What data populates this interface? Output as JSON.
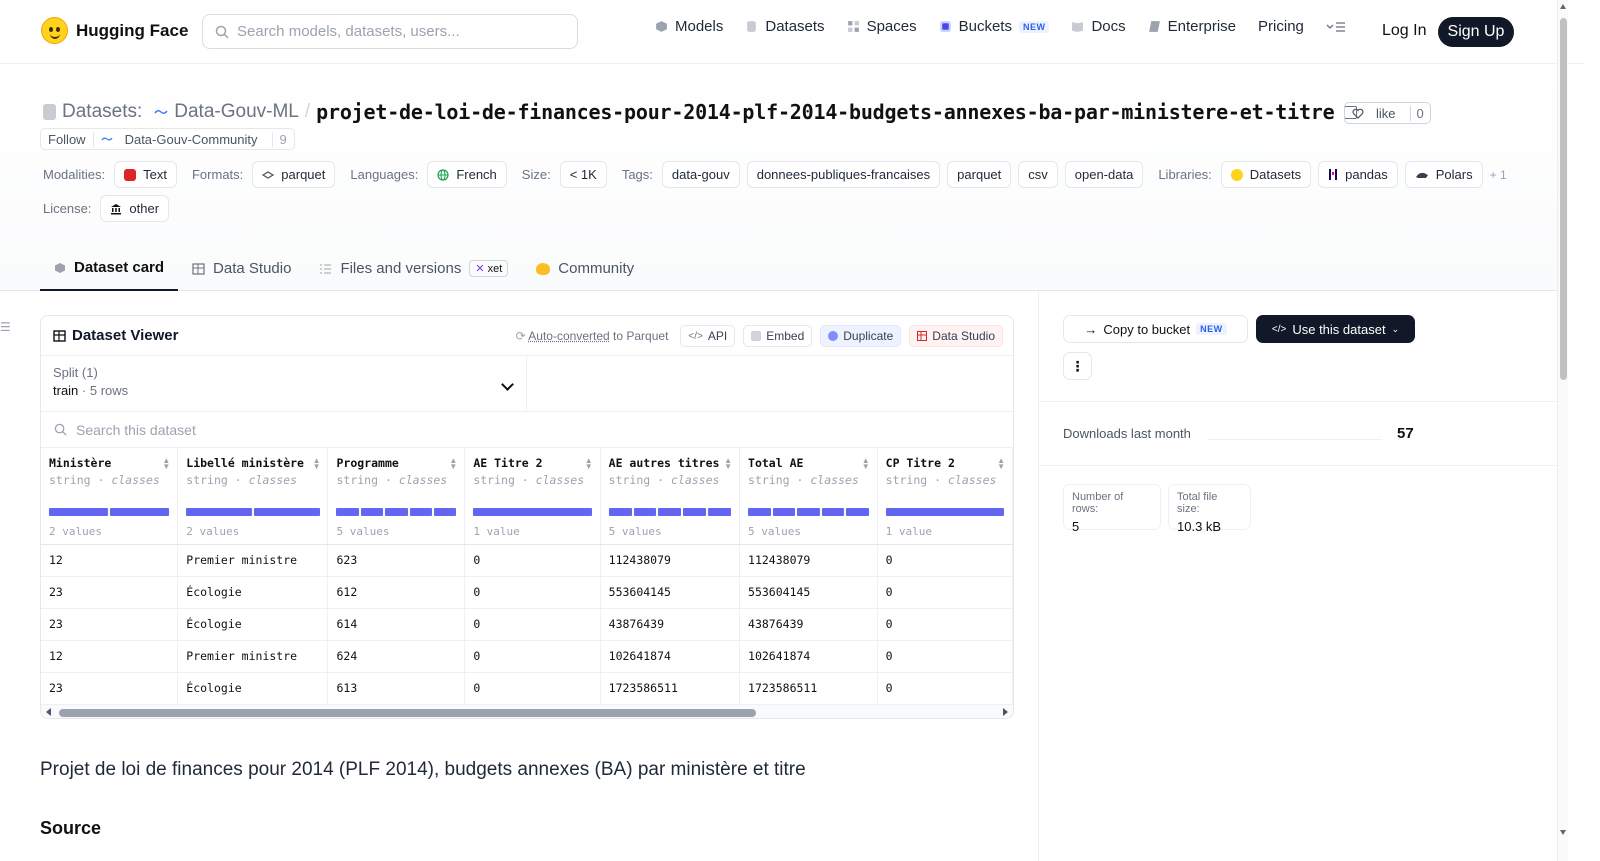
{
  "nav": {
    "brand": "Hugging Face",
    "search_placeholder": "Search models, datasets, users...",
    "links": [
      {
        "label": "Models",
        "icon": "cube-icon"
      },
      {
        "label": "Datasets",
        "icon": "database-icon"
      },
      {
        "label": "Spaces",
        "icon": "grid-icon"
      },
      {
        "label": "Buckets",
        "icon": "bucket-icon",
        "badge": "NEW"
      },
      {
        "label": "Docs",
        "icon": "book-icon"
      },
      {
        "label": "Enterprise",
        "icon": "enterprise-icon"
      },
      {
        "label": "Pricing"
      }
    ],
    "login": "Log In",
    "signup": "Sign Up"
  },
  "header": {
    "datasets_label": "Datasets:",
    "org": "Data-Gouv-ML",
    "separator": "/",
    "slug": "projet-de-loi-de-finances-pour-2014-plf-2014-budgets-annexes-ba-par-ministere-et-titre",
    "like_label": "like",
    "like_count": "0",
    "follow_label": "Follow",
    "community_name": "Data-Gouv-Community",
    "follow_count": "9"
  },
  "tags": {
    "modalities_label": "Modalities:",
    "modalities": [
      "Text"
    ],
    "formats_label": "Formats:",
    "formats": [
      "parquet"
    ],
    "languages_label": "Languages:",
    "languages": [
      "French"
    ],
    "size_label": "Size:",
    "size": "< 1K",
    "tags_label": "Tags:",
    "tags": [
      "data-gouv",
      "donnees-publiques-francaises",
      "parquet",
      "csv",
      "open-data"
    ],
    "libraries_label": "Libraries:",
    "libraries": [
      "Datasets",
      "pandas",
      "Polars"
    ],
    "libraries_more": "+ 1",
    "license_label": "License:",
    "license": "other"
  },
  "tabs": [
    {
      "label": "Dataset card",
      "active": true
    },
    {
      "label": "Data Studio"
    },
    {
      "label": "Files and versions",
      "badge": "xet"
    },
    {
      "label": "Community"
    }
  ],
  "viewer": {
    "title": "Dataset Viewer",
    "auto_converted": "Auto-converted",
    "to_parquet": "to Parquet",
    "api": "API",
    "embed": "Embed",
    "duplicate": "Duplicate",
    "data_studio": "Data Studio",
    "split_label": "Split (1)",
    "split_value": "train",
    "split_rows": "5 rows",
    "search_placeholder": "Search this dataset",
    "columns": [
      {
        "name": "Ministère",
        "type": "string",
        "kind": "classes",
        "values": "2 values",
        "bars": 2
      },
      {
        "name": "Libellé ministère",
        "type": "string",
        "kind": "classes",
        "values": "2 values",
        "bars": 2
      },
      {
        "name": "Programme",
        "type": "string",
        "kind": "classes",
        "values": "5 values",
        "bars": 5
      },
      {
        "name": "AE Titre 2",
        "type": "string",
        "kind": "classes",
        "values": "1 value",
        "bars": 1
      },
      {
        "name": "AE autres titres",
        "type": "string",
        "kind": "classes",
        "values": "5 values",
        "bars": 5
      },
      {
        "name": "Total AE",
        "type": "string",
        "kind": "classes",
        "values": "5 values",
        "bars": 5
      },
      {
        "name": "CP Titre 2",
        "type": "string",
        "kind": "classes",
        "values": "1 value",
        "bars": 1
      }
    ],
    "rows": [
      [
        "12",
        "Premier ministre",
        "623",
        "0",
        "112438079",
        "112438079",
        "0"
      ],
      [
        "23",
        "Écologie",
        "612",
        "0",
        "553604145",
        "553604145",
        "0"
      ],
      [
        "23",
        "Écologie",
        "614",
        "0",
        "43876439",
        "43876439",
        "0"
      ],
      [
        "12",
        "Premier ministre",
        "624",
        "0",
        "102641874",
        "102641874",
        "0"
      ],
      [
        "23",
        "Écologie",
        "613",
        "0",
        "1723586511",
        "1723586511",
        "0"
      ]
    ]
  },
  "side": {
    "copy_to_bucket": "Copy to bucket",
    "copy_badge": "NEW",
    "use_dataset": "Use this dataset",
    "more": "⋮",
    "downloads_label": "Downloads last month",
    "downloads_value": "57",
    "rows_label": "Number of rows:",
    "rows_value": "5",
    "filesize_label": "Total file size:",
    "filesize_value": "10.3 kB"
  },
  "card": {
    "heading": "Projet de loi de finances pour 2014 (PLF 2014), budgets annexes (BA) par ministère et titre",
    "source_heading": "Source"
  }
}
